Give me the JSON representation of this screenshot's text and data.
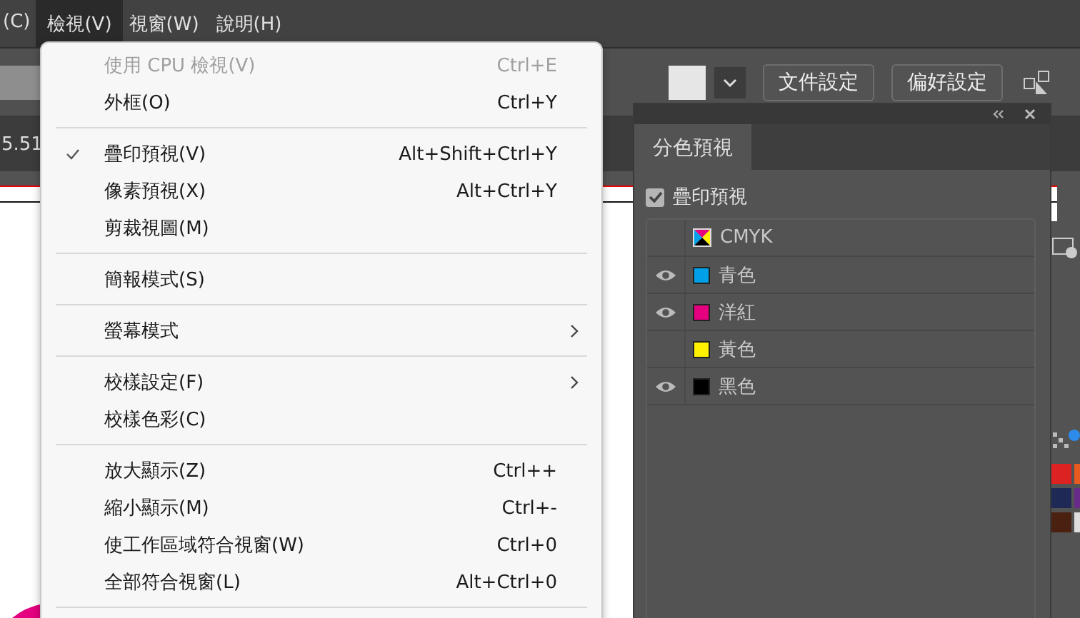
{
  "menubar": [
    {
      "label": "(C)",
      "selected": false
    },
    {
      "label": "檢視(V)",
      "selected": true
    },
    {
      "label": "視窗(W)",
      "selected": false
    },
    {
      "label": "說明(H)",
      "selected": false
    }
  ],
  "toolbar": {
    "buttons": [
      "文件設定",
      "偏好設定"
    ]
  },
  "document_tab": {
    "label": "5.51"
  },
  "view_menu": [
    {
      "kind": "item",
      "label": "使用 CPU 檢視(V)",
      "shortcut": "Ctrl+E",
      "checked": false,
      "disabled": true,
      "submenu": false
    },
    {
      "kind": "item",
      "label": "外框(O)",
      "shortcut": "Ctrl+Y",
      "checked": false,
      "disabled": false,
      "submenu": false
    },
    {
      "kind": "separator"
    },
    {
      "kind": "item",
      "label": "疊印預視(V)",
      "shortcut": "Alt+Shift+Ctrl+Y",
      "checked": true,
      "disabled": false,
      "submenu": false
    },
    {
      "kind": "item",
      "label": "像素預視(X)",
      "shortcut": "Alt+Ctrl+Y",
      "checked": false,
      "disabled": false,
      "submenu": false
    },
    {
      "kind": "item",
      "label": "剪裁視圖(M)",
      "checked": false,
      "disabled": false,
      "submenu": false
    },
    {
      "kind": "separator"
    },
    {
      "kind": "item",
      "label": "簡報模式(S)",
      "checked": false,
      "disabled": false,
      "submenu": false
    },
    {
      "kind": "separator"
    },
    {
      "kind": "item",
      "label": "螢幕模式",
      "checked": false,
      "disabled": false,
      "submenu": true
    },
    {
      "kind": "separator"
    },
    {
      "kind": "item",
      "label": "校樣設定(F)",
      "checked": false,
      "disabled": false,
      "submenu": true
    },
    {
      "kind": "item",
      "label": "校樣色彩(C)",
      "checked": false,
      "disabled": false,
      "submenu": false
    },
    {
      "kind": "separator"
    },
    {
      "kind": "item",
      "label": "放大顯示(Z)",
      "shortcut": "Ctrl++",
      "checked": false,
      "disabled": false,
      "submenu": false
    },
    {
      "kind": "item",
      "label": "縮小顯示(M)",
      "shortcut": "Ctrl+-",
      "checked": false,
      "disabled": false,
      "submenu": false
    },
    {
      "kind": "item",
      "label": "使工作區域符合視窗(W)",
      "shortcut": "Ctrl+0",
      "checked": false,
      "disabled": false,
      "submenu": false
    },
    {
      "kind": "item",
      "label": "全部符合視窗(L)",
      "shortcut": "Alt+Ctrl+0",
      "checked": false,
      "disabled": false,
      "submenu": false
    },
    {
      "kind": "separator"
    }
  ],
  "separations_panel": {
    "tabs": [
      {
        "label": "分色預視",
        "selected": true
      }
    ],
    "overprint_preview": {
      "label": "疊印預視",
      "checked": true
    },
    "inks": [
      {
        "kind": "composite",
        "name": "CMYK",
        "visible": false
      },
      {
        "kind": "plate",
        "name": "青色",
        "visible": true,
        "color": "#00a0e9"
      },
      {
        "kind": "plate",
        "name": "洋紅",
        "visible": true,
        "color": "#e4007f"
      },
      {
        "kind": "plate",
        "name": "黃色",
        "visible": false,
        "color": "#fff100"
      },
      {
        "kind": "plate",
        "name": "黑色",
        "visible": true,
        "color": "#000000"
      }
    ]
  }
}
